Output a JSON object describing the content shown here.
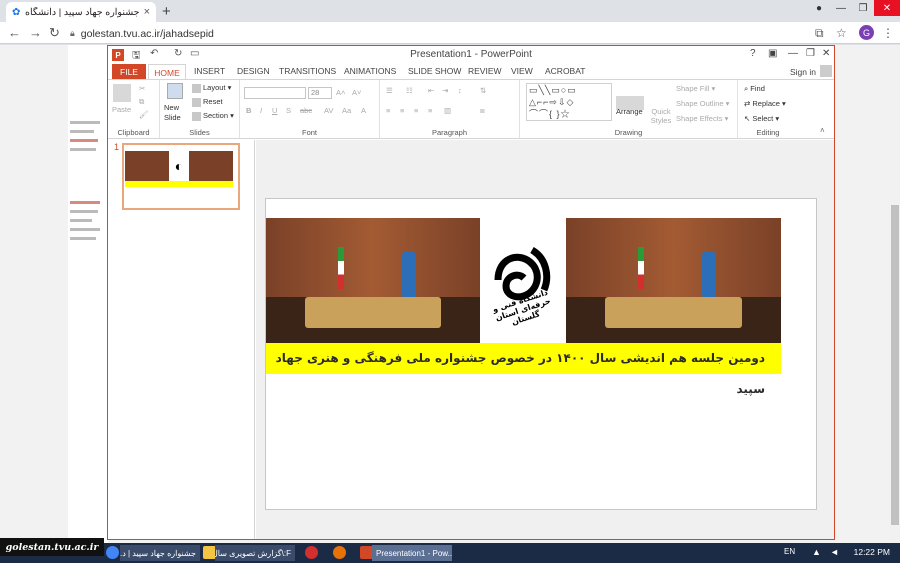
{
  "browser": {
    "tab_title": "جشنواره جهاد سپید | دانشگاه فنی و حرفه",
    "new_tab_symbol": "+",
    "url": "golestan.tvu.ac.ir/jahadsepid",
    "profile_initial": "G"
  },
  "ppt": {
    "window_title": "Presentation1 - PowerPoint",
    "logo_letter": "P",
    "tabs": [
      "FILE",
      "HOME",
      "INSERT",
      "DESIGN",
      "TRANSITIONS",
      "ANIMATIONS",
      "SLIDE SHOW",
      "REVIEW",
      "VIEW",
      "ACROBAT"
    ],
    "sign_in": "Sign in",
    "help": "?",
    "font_size": "28",
    "groups": {
      "clipboard": "Clipboard",
      "slides": "Slides",
      "font": "Font",
      "paragraph": "Paragraph",
      "drawing": "Drawing",
      "editing": "Editing"
    },
    "buttons": {
      "paste": "Paste",
      "new_slide": "New Slide",
      "layout": "Layout",
      "reset": "Reset",
      "section": "Section",
      "arrange": "Arrange",
      "quick_styles": "Quick Styles",
      "shape_fill": "Shape Fill",
      "shape_outline": "Shape Outline",
      "shape_effects": "Shape Effects",
      "find": "Find",
      "replace": "Replace",
      "select": "Select"
    },
    "slide_number": "1",
    "slide_caption": "دومین جلسه هم اندیشی سال ۱۴۰۰ در خصوص جشنواره ملی فرهنگی و هنری جهاد سپید",
    "logo_caption": "دانشگاه فنی و حرفه‌ای استان گلستان"
  },
  "taskbar": {
    "watermark": "golestan.tvu.ac.ir",
    "items": [
      "جشنواره جهاد سپید | د...",
      "F:\\گزارش تصویری سال...",
      "Presentation1 - Pow..."
    ],
    "language": "EN",
    "time": "12:22 PM"
  },
  "colors": {
    "ppt_accent": "#d24726",
    "caption_bg": "#ffff00"
  }
}
